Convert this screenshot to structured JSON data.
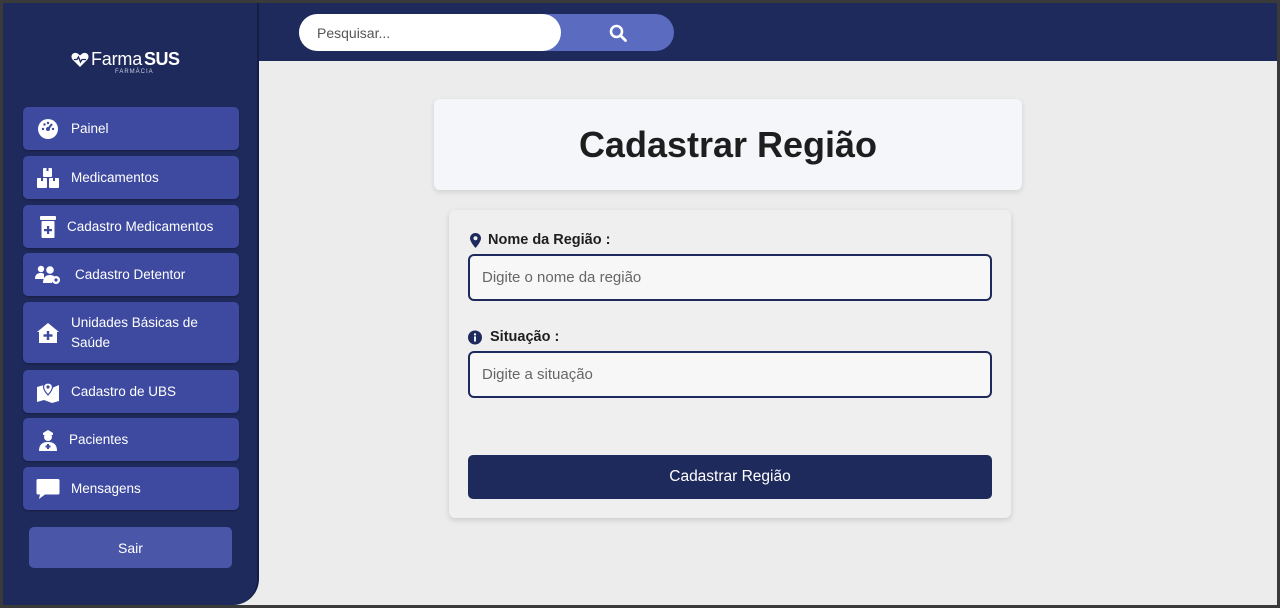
{
  "search": {
    "placeholder": "Pesquisar..."
  },
  "logo": {
    "farma": "Farma",
    "sus": "SUS",
    "sub": "FARMÁCIA"
  },
  "sidebar": {
    "items": [
      {
        "label": "Painel",
        "icon": "gauge-icon"
      },
      {
        "label": "Medicamentos",
        "icon": "boxes-icon"
      },
      {
        "label": "Cadastro Medicamentos",
        "icon": "prescription-bottle-icon"
      },
      {
        "label": "Cadastro Detentor",
        "icon": "users-gear-icon"
      },
      {
        "label": "Unidades Básicas de Saúde",
        "icon": "house-medical-icon"
      },
      {
        "label": "Cadastro de UBS",
        "icon": "map-location-icon"
      },
      {
        "label": "Pacientes",
        "icon": "user-nurse-icon"
      },
      {
        "label": "Mensagens",
        "icon": "message-icon"
      }
    ],
    "logout_label": "Sair"
  },
  "page": {
    "title": "Cadastrar Região"
  },
  "form": {
    "region_name": {
      "label": "Nome da Região :",
      "placeholder": "Digite o nome da região",
      "value": ""
    },
    "status": {
      "label": "Situação :",
      "placeholder": "Digite a situação",
      "value": ""
    },
    "submit_label": "Cadastrar Região"
  },
  "colors": {
    "navy": "#1f2a5c",
    "nav_item": "#3d4a9f",
    "accent": "#5b6bbf",
    "background": "#ececec"
  }
}
